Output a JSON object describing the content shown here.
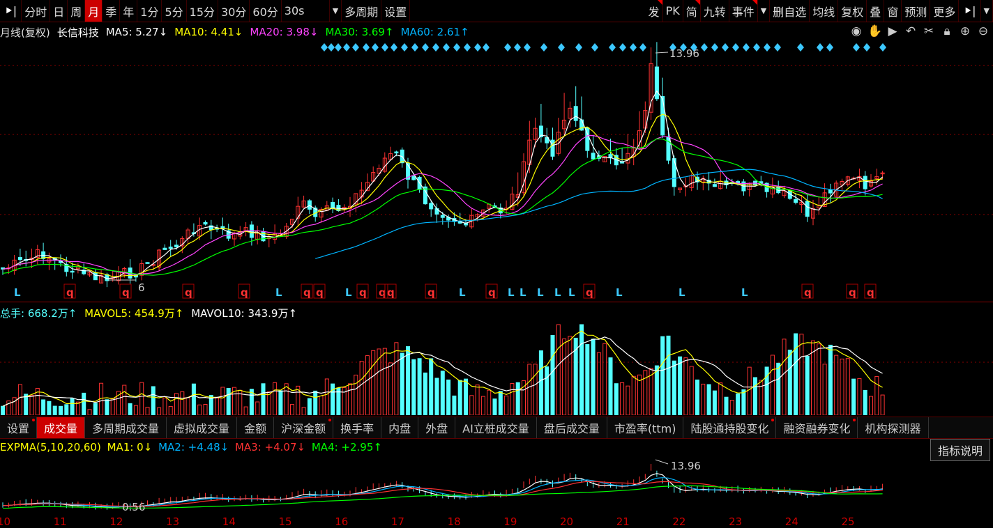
{
  "toolbar": {
    "left": [
      {
        "label": "分时",
        "active": false
      },
      {
        "label": "日",
        "active": false
      },
      {
        "label": "周",
        "active": false
      },
      {
        "label": "月",
        "active": true
      },
      {
        "label": "季",
        "active": false
      },
      {
        "label": "年",
        "active": false
      },
      {
        "label": "1分",
        "active": false
      },
      {
        "label": "5分",
        "active": false
      },
      {
        "label": "15分",
        "active": false
      },
      {
        "label": "30分",
        "active": false
      },
      {
        "label": "60分",
        "active": false
      },
      {
        "label": "30s",
        "active": false
      },
      {
        "label": "多周期",
        "active": false
      },
      {
        "label": "设置",
        "active": false
      }
    ],
    "right": [
      {
        "label": "发",
        "flag": true
      },
      {
        "label": "PK",
        "flag": false
      },
      {
        "label": "简",
        "flag": true
      },
      {
        "label": "九转",
        "flag": false
      },
      {
        "label": "事件",
        "flag": true
      },
      {
        "label": "删自选",
        "flag": false
      },
      {
        "label": "均线",
        "flag": false
      },
      {
        "label": "复权",
        "flag": false
      },
      {
        "label": "叠",
        "flag": false
      },
      {
        "label": "窗",
        "flag": false
      },
      {
        "label": "预测",
        "flag": false
      },
      {
        "label": "更多",
        "flag": false
      }
    ]
  },
  "chart_info": {
    "period": "月线(复权)",
    "name": "长信科技",
    "ma5": "MA5: 5.27↓",
    "ma10": "MA10: 4.41↓",
    "ma20": "MA20: 3.98↓",
    "ma30": "MA30: 3.69↑",
    "ma60": "MA60: 2.61↑"
  },
  "annotations": {
    "high": "13.96",
    "low": "6",
    "expma_high": "13.96",
    "expma_low": "0.56"
  },
  "volume_info": {
    "total": "总手: 668.2万↑",
    "mavol5": "MAVOL5: 454.9万↑",
    "mavol10": "MAVOL10: 343.9万↑"
  },
  "indicator_tabs": [
    {
      "label": "设置",
      "dot": true,
      "active": false
    },
    {
      "label": "成交量",
      "dot": false,
      "active": true
    },
    {
      "label": "多周期成交量",
      "dot": false,
      "active": false
    },
    {
      "label": "虚拟成交量",
      "dot": false,
      "active": false
    },
    {
      "label": "金额",
      "dot": false,
      "active": false
    },
    {
      "label": "沪深金额",
      "dot": true,
      "active": false
    },
    {
      "label": "换手率",
      "dot": false,
      "active": false
    },
    {
      "label": "内盘",
      "dot": false,
      "active": false
    },
    {
      "label": "外盘",
      "dot": false,
      "active": false
    },
    {
      "label": "AI立桩成交量",
      "dot": false,
      "active": false
    },
    {
      "label": "盘后成交量",
      "dot": false,
      "active": false
    },
    {
      "label": "市盈率(ttm)",
      "dot": false,
      "active": false
    },
    {
      "label": "陆股通持股变化",
      "dot": true,
      "active": false
    },
    {
      "label": "融资融券变化",
      "dot": true,
      "active": false
    },
    {
      "label": "机构探测器",
      "dot": false,
      "active": false
    }
  ],
  "expma_info": {
    "name": "EXPMA(5,10,20,60)",
    "ma1": "MA1: 0↓",
    "ma2": "MA2: +4.48↓",
    "ma3": "MA3: +4.07↓",
    "ma4": "MA4: +2.95↑"
  },
  "indicator_button": "指标说明",
  "x_axis": [
    "10",
    "11",
    "12",
    "13",
    "14",
    "15",
    "16",
    "17",
    "18",
    "19",
    "20",
    "21",
    "22",
    "23",
    "24",
    "25"
  ],
  "signals": [
    "L",
    "q",
    "q",
    "q",
    "q",
    "L",
    "q",
    "q",
    "L",
    "q",
    "q",
    "q",
    "q",
    "L",
    "q",
    "L",
    "L",
    "L",
    "L",
    "L",
    "q",
    "L",
    "L",
    "L",
    "q",
    "q",
    "q",
    "q",
    "L",
    "q"
  ],
  "colors": {
    "up": "#ff3232",
    "down": "#54ffff",
    "ma5": "#ffffff",
    "ma10": "#ffff00",
    "ma20": "#ff44ff",
    "ma30": "#00ff00",
    "ma60": "#00b4ff",
    "grid": "#8a0000"
  }
}
